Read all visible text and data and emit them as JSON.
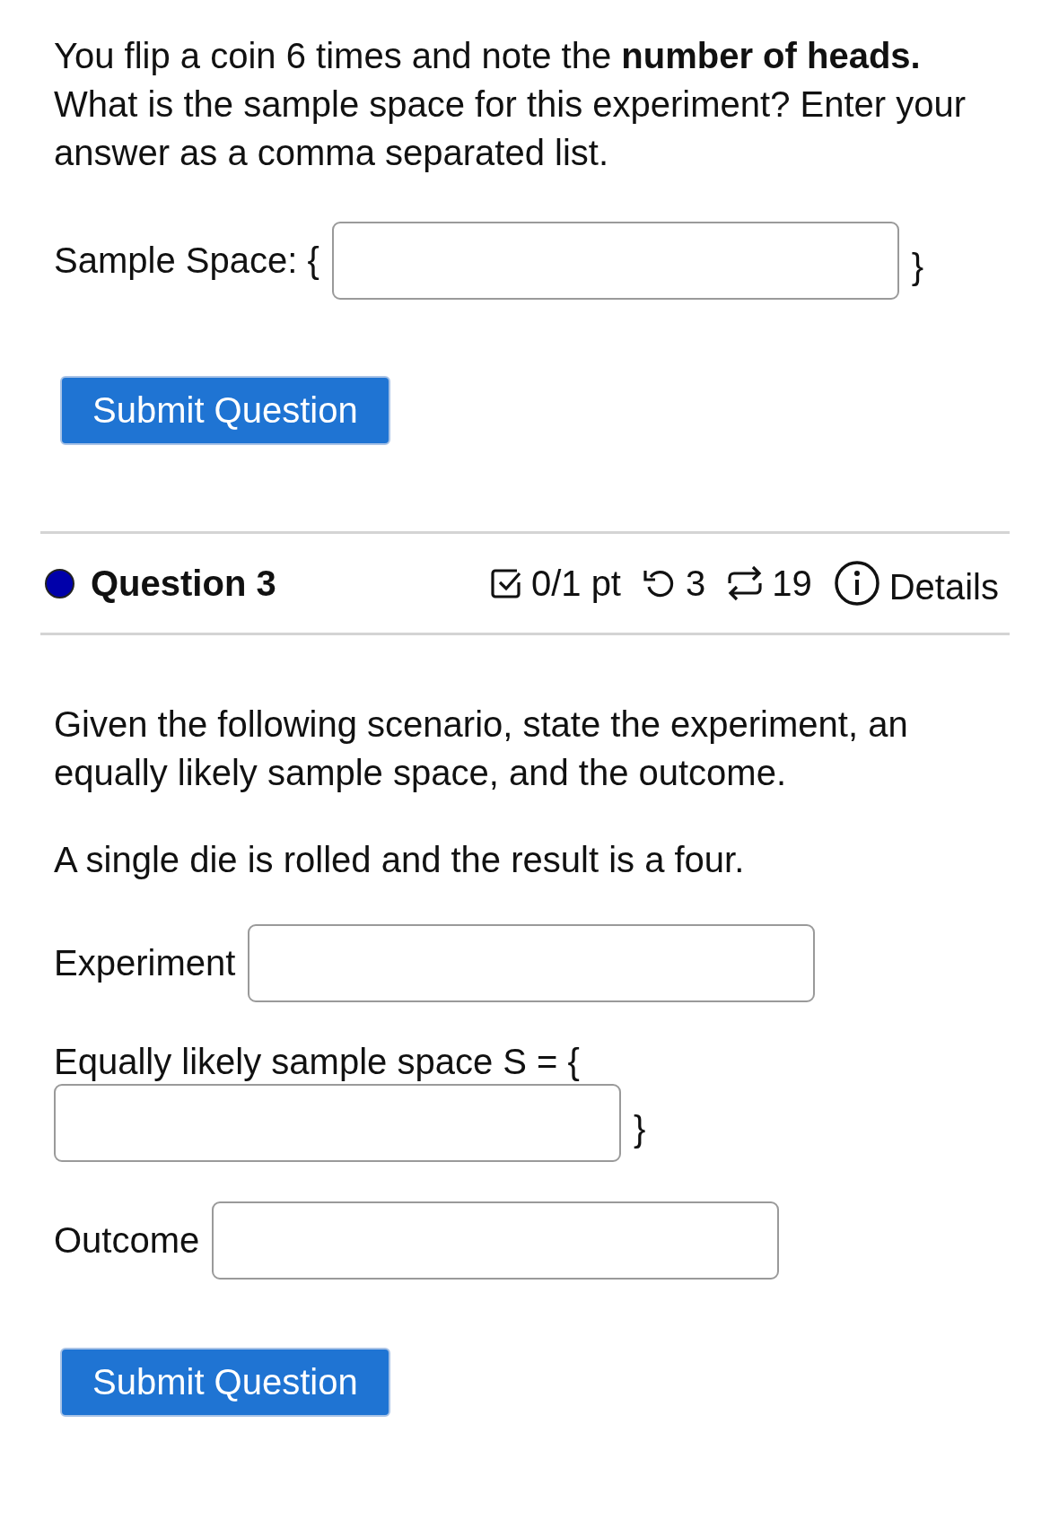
{
  "previous_question": {
    "text": "You flip a coin 6 times and note the **number of heads.** What is the sample space for this experiment? Enter your answer as a comma separated list.",
    "fields": [
      {
        "label": "Sample Space: {",
        "suffix": "}"
      }
    ],
    "submit": "Submit Question"
  },
  "question": {
    "status_dot": {
      "color": "#0000aa"
    },
    "title": "Question 3",
    "score": "0/1 pt",
    "retries": "3",
    "attempts": "19",
    "details": "Details",
    "paragraphs": [
      "Given the following scenario, state the experiment, an equally likely sample space, and the outcome.",
      "A single die is rolled and the result is a four."
    ],
    "fields": [
      {
        "label": "Experiment"
      },
      {
        "label": "Equally likely sample space S = {",
        "suffix": "}"
      },
      {
        "label": "Outcome"
      }
    ],
    "submit": "Submit Question"
  }
}
